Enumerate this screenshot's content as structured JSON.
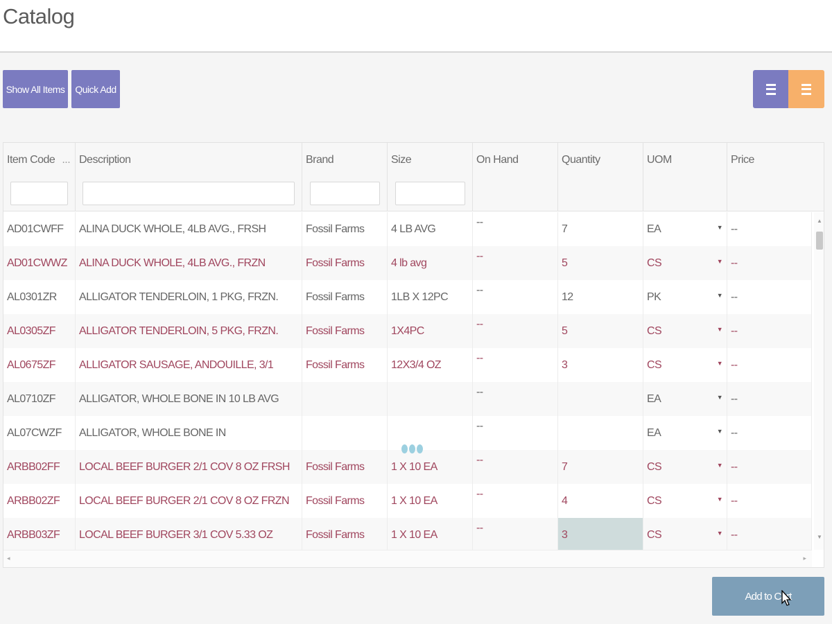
{
  "page": {
    "title": "Catalog"
  },
  "toolbar": {
    "show_all_label": "Show All Items",
    "quick_add_label": "Quick Add",
    "view_list_icon": "list-view-icon",
    "view_grid_icon": "grid-view-icon",
    "colors": {
      "primary": "#7b7bc0",
      "accent": "#f7b06a",
      "cart": "#7d9fb8",
      "row_text_red": "#a0465e"
    }
  },
  "grid": {
    "columns": [
      {
        "label": "Item Code",
        "sort_indicator": "...",
        "filter_value": "",
        "filter_placeholder": ""
      },
      {
        "label": "Description",
        "filter_value": "",
        "filter_placeholder": ""
      },
      {
        "label": "Brand",
        "filter_value": "",
        "filter_placeholder": ""
      },
      {
        "label": "Size",
        "filter_value": "",
        "filter_placeholder": ""
      },
      {
        "label": "On Hand"
      },
      {
        "label": "Quantity"
      },
      {
        "label": "UOM"
      },
      {
        "label": "Price"
      }
    ],
    "rows": [
      {
        "code": "AD01CWFF",
        "description": "ALINA DUCK WHOLE, 4LB AVG., FRSH",
        "brand": "Fossil Farms",
        "size": "4 LB AVG",
        "on_hand": "--",
        "quantity": "7",
        "uom": "EA",
        "price": "--",
        "style": "gray"
      },
      {
        "code": "AD01CWWZ",
        "description": "ALINA DUCK WHOLE, 4LB AVG., FRZN",
        "brand": "Fossil Farms",
        "size": "4 lb avg",
        "on_hand": "--",
        "quantity": "5",
        "uom": "CS",
        "price": "--",
        "style": "red"
      },
      {
        "code": "AL0301ZR",
        "description": "ALLIGATOR TENDERLOIN, 1 PKG, FRZN.",
        "brand": "Fossil Farms",
        "size": "1LB X 12PC",
        "on_hand": "--",
        "quantity": "12",
        "uom": "PK",
        "price": "--",
        "style": "gray"
      },
      {
        "code": "AL0305ZF",
        "description": "ALLIGATOR TENDERLOIN, 5 PKG, FRZN.",
        "brand": "Fossil Farms",
        "size": "1X4PC",
        "on_hand": "--",
        "quantity": "5",
        "uom": "CS",
        "price": "--",
        "style": "red"
      },
      {
        "code": "AL0675ZF",
        "description": "ALLIGATOR SAUSAGE, ANDOUILLE, 3/1",
        "brand": "Fossil Farms",
        "size": "12X3/4 OZ",
        "on_hand": "--",
        "quantity": "3",
        "uom": "CS",
        "price": "--",
        "style": "red"
      },
      {
        "code": "AL0710ZF",
        "description": "ALLIGATOR, WHOLE BONE IN 10 LB AVG",
        "brand": "",
        "size": "",
        "on_hand": "--",
        "quantity": "",
        "uom": "EA",
        "price": "--",
        "style": "gray"
      },
      {
        "code": "AL07CWZF",
        "description": "ALLIGATOR, WHOLE BONE IN",
        "brand": "",
        "size": "",
        "on_hand": "--",
        "quantity": "",
        "uom": "EA",
        "price": "--",
        "style": "gray"
      },
      {
        "code": "ARBB02FF",
        "description": "LOCAL BEEF BURGER 2/1 COV 8 OZ FRSH",
        "brand": "Fossil Farms",
        "size": "1 X 10 EA",
        "on_hand": "--",
        "quantity": "7",
        "uom": "CS",
        "price": "--",
        "style": "red"
      },
      {
        "code": "ARBB02ZF",
        "description": "LOCAL BEEF BURGER 2/1 COV 8 OZ FRZN",
        "brand": "Fossil Farms",
        "size": "1 X 10 EA",
        "on_hand": "--",
        "quantity": "4",
        "uom": "CS",
        "price": "--",
        "style": "red"
      },
      {
        "code": "ARBB03ZF",
        "description": "LOCAL BEEF BURGER 3/1 COV 5.33 OZ",
        "brand": "Fossil Farms",
        "size": "1 X 10 EA",
        "on_hand": "--",
        "quantity": "3",
        "uom": "CS",
        "price": "--",
        "style": "red",
        "highlight_qty": true
      }
    ]
  },
  "footer": {
    "add_to_cart_label": "Add to Cart"
  }
}
